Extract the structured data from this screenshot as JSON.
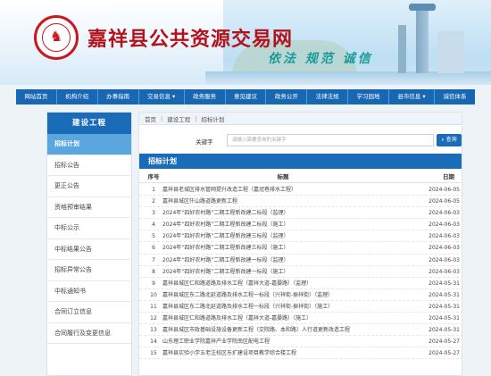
{
  "header": {
    "site_title": "嘉祥县公共资源交易网",
    "slogan": "依法 规范 诚信"
  },
  "nav": {
    "items": [
      "网站首页",
      "机构介绍",
      "办事指南",
      "交易信息 ▾",
      "政务服务",
      "意见建议",
      "政务公开",
      "法律法规",
      "学习园地",
      "县市信息 ▾",
      "诚信体系"
    ]
  },
  "sidebar": {
    "title": "建设工程",
    "items": [
      "招标计划",
      "招标公告",
      "更正公告",
      "资格预审结果",
      "中标公示",
      "中标结果公告",
      "招标异常公告",
      "中标通知书",
      "合同订立信息",
      "合同履行及变更信息"
    ]
  },
  "breadcrumb": [
    "首页",
    "建设工程",
    "招标计划"
  ],
  "search": {
    "label": "关键字",
    "placeholder": "请输入需要查询的关键字",
    "button": "查询"
  },
  "list": {
    "title": "招标计划",
    "headers": {
      "no": "序号",
      "title": "标题",
      "date": "日期"
    },
    "rows": [
      {
        "no": "1",
        "title": "嘉祥县老城区排水管网提升改造工程（嘉冠巷排水工程）",
        "date": "2024-06-05"
      },
      {
        "no": "2",
        "title": "嘉祥县城区仟山路道路更新工程",
        "date": "2024-06-05"
      },
      {
        "no": "3",
        "title": "2024年“四好农村路”二期工程新改建二标段（监理）",
        "date": "2024-06-03"
      },
      {
        "no": "4",
        "title": "2024年“四好农村路”二期工程新改建二标段（施工）",
        "date": "2024-06-03"
      },
      {
        "no": "5",
        "title": "2024年“四好农村路”二期工程新改建三标段（监理）",
        "date": "2024-06-03"
      },
      {
        "no": "6",
        "title": "2024年“四好农村路”二期工程新改建三标段（施工）",
        "date": "2024-06-03"
      },
      {
        "no": "7",
        "title": "2024年“四好农村路”二期工程新改建一标段（监理）",
        "date": "2024-06-03"
      },
      {
        "no": "8",
        "title": "2024年“四好农村路”二期工程新改建一标段（施工）",
        "date": "2024-06-03"
      },
      {
        "no": "9",
        "title": "嘉祥县城区仁和路道路及排水工程（嘉祥大道-嘉晏路）（监理）",
        "date": "2024-05-31"
      },
      {
        "no": "10",
        "title": "嘉祥县城区东二路北延道路及排水工程一标段（兴祥街-振祥街）（监理）",
        "date": "2024-05-31"
      },
      {
        "no": "11",
        "title": "嘉祥县城区东二路北延道路及排水工程一标段（兴祥街-振祥街）（施工）",
        "date": "2024-05-31"
      },
      {
        "no": "12",
        "title": "嘉祥县城区仁和路道路及排水工程（嘉祥大道-嘉晏路）（施工）",
        "date": "2024-05-31"
      },
      {
        "no": "13",
        "title": "嘉祥县城区市政基础设施设备更新工程（交院路、本和路）人行道更新改造工程",
        "date": "2024-05-31"
      },
      {
        "no": "14",
        "title": "山东理工职业学院嘉祥产业学院南区配电工程",
        "date": "2024-05-27"
      },
      {
        "no": "15",
        "title": "嘉祥县实验小学五老注校区东扩建设项目教学综合楼工程",
        "date": "2024-05-27"
      }
    ]
  },
  "colors": {
    "primary": "#1a6bb8",
    "title_red": "#b3121c",
    "active": "#5aa6de"
  }
}
